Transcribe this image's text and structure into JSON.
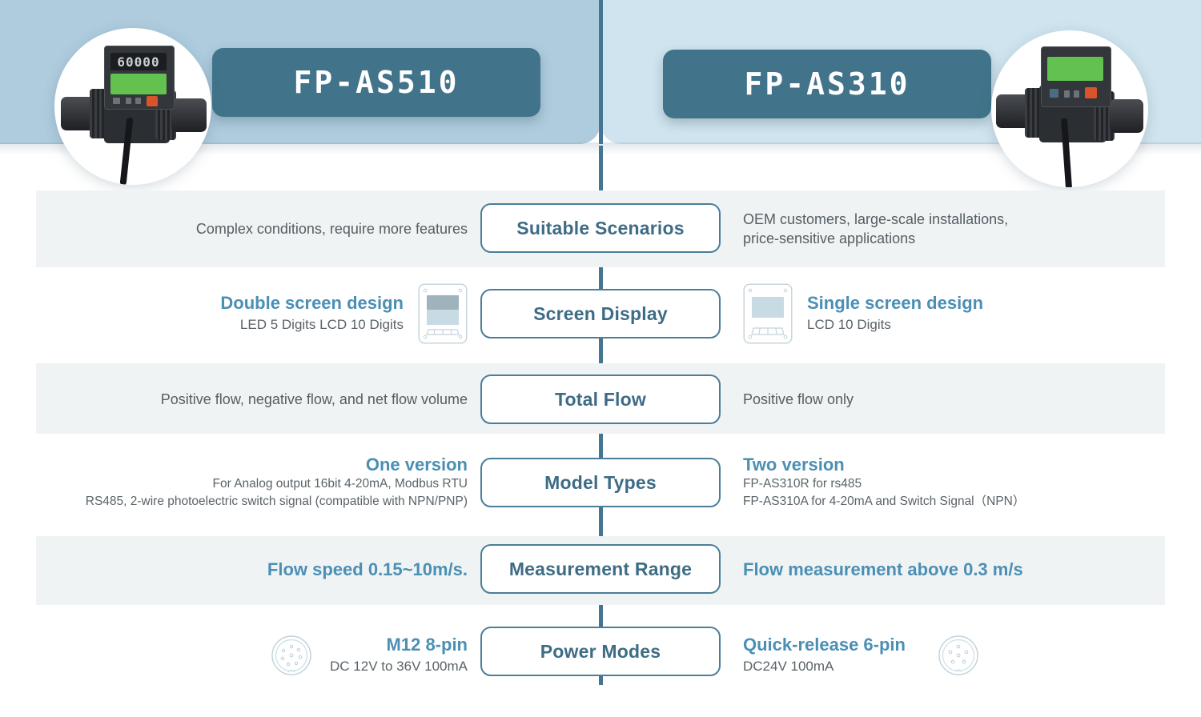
{
  "header": {
    "left": {
      "title": "FP-AS510",
      "photo_alt": "flow-meter-double-screen",
      "bg": "#aeccdd",
      "pill_bg": "#41738a"
    },
    "right": {
      "title": "FP-AS310",
      "photo_alt": "flow-meter-single-screen",
      "bg": "#cfe4ee",
      "pill_bg": "#41738a"
    },
    "device_led_value": "60000"
  },
  "colors": {
    "spine": "#447692",
    "band": "#eff3f4",
    "pill_border": "#4a7e99",
    "pill_text": "#3e6c85",
    "highlight": "#4b8fb5",
    "body_text": "#5a6368"
  },
  "rows": [
    {
      "id": "suitable-scenarios",
      "label": "Suitable Scenarios",
      "left": {
        "title": "",
        "lines": [
          "Complex conditions, require more features"
        ],
        "icon": ""
      },
      "right": {
        "title": "",
        "lines": [
          "OEM customers, large-scale installations,",
          "price-sensitive applications"
        ],
        "icon": ""
      },
      "banded": true
    },
    {
      "id": "screen-display",
      "label": "Screen Display",
      "left": {
        "title": "Double screen design",
        "lines": [
          "LED 5 Digits LCD 10 Digits"
        ],
        "icon": "screen-double-icon"
      },
      "right": {
        "title": "Single screen design",
        "lines": [
          "LCD 10 Digits"
        ],
        "icon": "screen-single-icon"
      },
      "banded": false
    },
    {
      "id": "total-flow",
      "label": "Total Flow",
      "left": {
        "title": "",
        "lines": [
          "Positive flow, negative flow, and net flow volume"
        ],
        "icon": ""
      },
      "right": {
        "title": "",
        "lines": [
          "Positive flow only"
        ],
        "icon": ""
      },
      "banded": true
    },
    {
      "id": "model-types",
      "label": "Model Types",
      "left": {
        "title": "One version",
        "lines": [
          "For Analog output 16bit 4-20mA, Modbus RTU",
          "RS485, 2-wire photoelectric switch signal (compatible with NPN/PNP)"
        ],
        "icon": ""
      },
      "right": {
        "title": "Two version",
        "lines": [
          "FP-AS310R for rs485",
          "FP-AS310A for 4-20mA and Switch Signal（NPN）"
        ],
        "icon": ""
      },
      "banded": false
    },
    {
      "id": "measurement-range",
      "label": "Measurement Range",
      "left": {
        "title": "Flow speed 0.15~10m/s.",
        "lines": [],
        "icon": ""
      },
      "right": {
        "title": "Flow measurement above 0.3 m/s",
        "lines": [],
        "icon": ""
      },
      "banded": true
    },
    {
      "id": "power-modes",
      "label": "Power Modes",
      "left": {
        "title": "M12 8-pin",
        "lines": [
          "DC 12V to 36V 100mA"
        ],
        "icon": "connector-8pin-icon"
      },
      "right": {
        "title": "Quick-release 6-pin",
        "lines": [
          "DC24V 100mA"
        ],
        "icon": "connector-6pin-icon"
      },
      "banded": false
    }
  ]
}
